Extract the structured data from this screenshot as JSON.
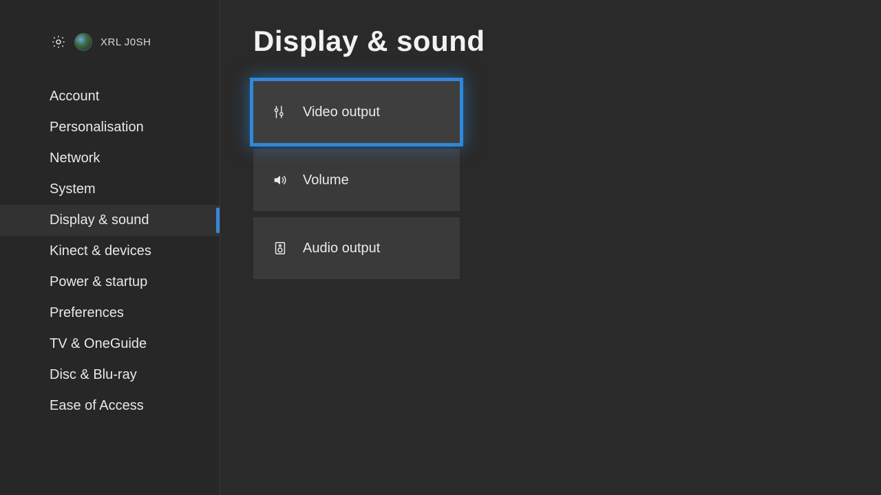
{
  "header": {
    "username": "XRL J0SH"
  },
  "sidebar": {
    "items": [
      {
        "label": "Account"
      },
      {
        "label": "Personalisation"
      },
      {
        "label": "Network"
      },
      {
        "label": "System"
      },
      {
        "label": "Display & sound"
      },
      {
        "label": "Kinect & devices"
      },
      {
        "label": "Power & startup"
      },
      {
        "label": "Preferences"
      },
      {
        "label": "TV & OneGuide"
      },
      {
        "label": "Disc & Blu-ray"
      },
      {
        "label": "Ease of Access"
      }
    ],
    "active_index": 4
  },
  "page": {
    "title": "Display & sound",
    "tiles": [
      {
        "label": "Video output",
        "icon": "video-settings-icon"
      },
      {
        "label": "Volume",
        "icon": "speaker-icon"
      },
      {
        "label": "Audio output",
        "icon": "audio-output-icon"
      }
    ],
    "focused_index": 0
  }
}
